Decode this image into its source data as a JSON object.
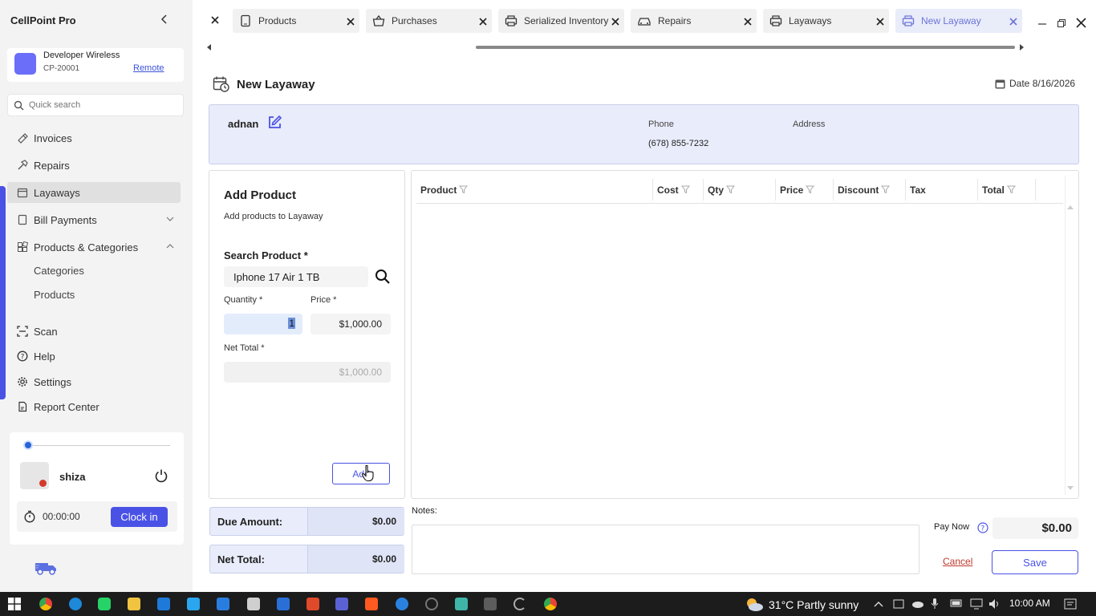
{
  "app": {
    "title": "CellPoint Pro"
  },
  "store": {
    "name": "Developer Wireless",
    "id": "CP-20001",
    "remote_label": "Remote"
  },
  "search": {
    "placeholder": "Quick search"
  },
  "nav": {
    "invoices": "Invoices",
    "repairs": "Repairs",
    "layaways": "Layaways",
    "bill_payments": "Bill Payments",
    "products_categories": "Products & Categories",
    "categories": "Categories",
    "products": "Products",
    "scan": "Scan",
    "help": "Help",
    "settings": "Settings",
    "report_center": "Report Center"
  },
  "user": {
    "name": "shiza",
    "timer": "00:00:00",
    "clock_in_label": "Clock in"
  },
  "tabs": [
    {
      "label": "Products",
      "icon": "tablet-icon"
    },
    {
      "label": "Purchases",
      "icon": "basket-icon"
    },
    {
      "label": "Serialized Inventory",
      "icon": "printer-icon"
    },
    {
      "label": "Repairs",
      "icon": "car-icon"
    },
    {
      "label": "Layaways",
      "icon": "printer-icon"
    },
    {
      "label": "New Layaway",
      "icon": "printer-icon",
      "active": true
    }
  ],
  "page": {
    "title": "New Layaway",
    "date_label": "Date",
    "date_value": "8/16/2026"
  },
  "customer": {
    "name": "adnan",
    "phone_label": "Phone",
    "phone_value": "(678) 855-7232",
    "address_label": "Address"
  },
  "add_product": {
    "title": "Add Product",
    "subtitle": "Add products to Layaway",
    "search_label": "Search Product *",
    "search_value": "Iphone 17 Air 1 TB",
    "quantity_label": "Quantity *",
    "quantity_value": "1",
    "price_label": "Price *",
    "price_value": "$1,000.00",
    "net_total_label": "Net Total *",
    "net_total_value": "$1,000.00",
    "add_button": "Add"
  },
  "grid": {
    "columns": [
      "Product",
      "Cost",
      "Qty",
      "Price",
      "Discount",
      "Tax",
      "Total"
    ]
  },
  "summary": {
    "due_label": "Due Amount:",
    "due_value": "$0.00",
    "net_label": "Net Total:",
    "net_value": "$0.00"
  },
  "notes": {
    "label": "Notes:"
  },
  "payment": {
    "pay_now_label": "Pay Now",
    "pay_now_value": "$0.00",
    "cancel_label": "Cancel",
    "save_label": "Save"
  },
  "taskbar": {
    "weather": "31°C  Partly sunny",
    "time": "10:00 AM"
  },
  "colors": {
    "accent": "#4a52e6",
    "customer_bg": "#e9ecfb",
    "cancel": "#c0392b"
  }
}
